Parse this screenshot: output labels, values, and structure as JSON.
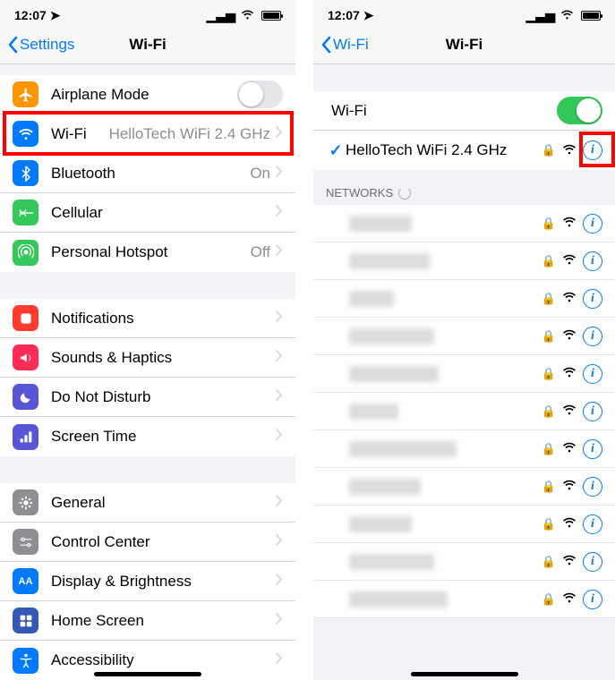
{
  "status": {
    "time": "12:07",
    "loc_arrow": "↗"
  },
  "left": {
    "back_label": "Settings",
    "title": "Wi-Fi",
    "rows1": [
      {
        "id": "airplane",
        "label": "Airplane Mode",
        "color": "#ff9500",
        "toggle": false
      },
      {
        "id": "wifi",
        "label": "Wi-Fi",
        "detail": "HelloTech WiFi 2.4 GHz",
        "color": "#007aff"
      },
      {
        "id": "bluetooth",
        "label": "Bluetooth",
        "detail": "On",
        "color": "#007aff"
      },
      {
        "id": "cellular",
        "label": "Cellular",
        "color": "#34c759"
      },
      {
        "id": "hotspot",
        "label": "Personal Hotspot",
        "detail": "Off",
        "color": "#34c759"
      }
    ],
    "rows2": [
      {
        "id": "notifications",
        "label": "Notifications",
        "color": "#ff3b30"
      },
      {
        "id": "sounds",
        "label": "Sounds & Haptics",
        "color": "#ff2d55"
      },
      {
        "id": "dnd",
        "label": "Do Not Disturb",
        "color": "#5856d6"
      },
      {
        "id": "screentime",
        "label": "Screen Time",
        "color": "#5856d6"
      }
    ],
    "rows3": [
      {
        "id": "general",
        "label": "General",
        "color": "#8e8e93"
      },
      {
        "id": "controlcenter",
        "label": "Control Center",
        "color": "#8e8e93"
      },
      {
        "id": "display",
        "label": "Display & Brightness",
        "color": "#007aff"
      },
      {
        "id": "homescreen",
        "label": "Home Screen",
        "color": "#3558b8"
      },
      {
        "id": "accessibility",
        "label": "Accessibility",
        "color": "#007aff"
      }
    ]
  },
  "right": {
    "back_label": "Wi-Fi",
    "title": "Wi-Fi",
    "toggle_label": "Wi-Fi",
    "toggle_on": true,
    "connected": "HelloTech WiFi 2.4 GHz",
    "networks_header": "NETWORKS",
    "networks_count": 11
  }
}
